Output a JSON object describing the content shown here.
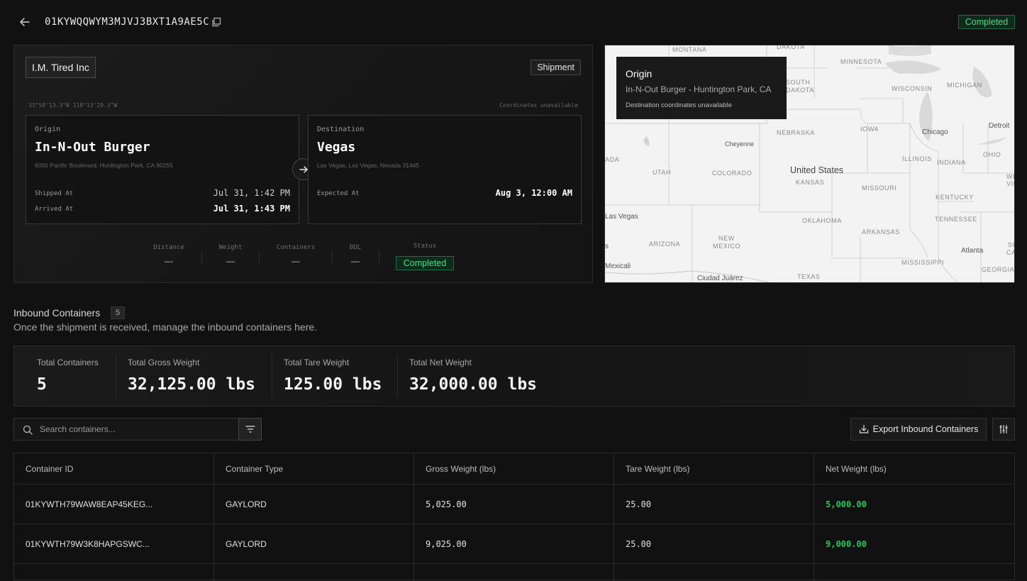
{
  "header": {
    "shipment_id": "01KYWQQWYM3MJVJ3BXT1A9AE5C",
    "status": "Completed"
  },
  "shipment": {
    "company": "I.M. Tired Inc",
    "type_badge": "Shipment",
    "origin_coords": "33°59'13.3\"N 118°13'29.3\"W",
    "dest_coords": "Coordinates unavailable",
    "origin": {
      "kind": "Origin",
      "name": "In-N-Out Burger",
      "address": "6000 Pacific Boulevard, Huntington Park, CA 90255",
      "shipped_label": "Shipped At",
      "shipped_value": "Jul 31, 1:42 PM",
      "arrived_label": "Arrived At",
      "arrived_value": "Jul 31, 1:43 PM"
    },
    "destination": {
      "kind": "Destination",
      "name": "Vegas",
      "address": "Las Vegas, Las Vegas, Nevada 31445",
      "expected_label": "Expected At",
      "expected_value": "Aug 3, 12:00 AM"
    },
    "stats": [
      {
        "label": "Distance",
        "value": "—"
      },
      {
        "label": "Weight",
        "value": "—"
      },
      {
        "label": "Containers",
        "value": "—"
      },
      {
        "label": "BOL",
        "value": "—"
      }
    ],
    "status_label": "Status",
    "status_value": "Completed"
  },
  "map": {
    "popup_title": "Origin",
    "popup_subtitle": "In-N-Out Burger - Huntington Park, CA",
    "popup_note": "Destination coordinates unavailable",
    "state_labels": [
      "MONTANA",
      "DAKOTA",
      "MINNESOTA",
      "SOUTH",
      "DAKOTA",
      "WISCONSIN",
      "MICHIGAN",
      "NEBRASKA",
      "IOWA",
      "UTAH",
      "COLORADO",
      "KANSAS",
      "ILLINOIS",
      "INDIANA",
      "OHIO",
      "MISSOURI",
      "KENTUCKY",
      "OKLAHOMA",
      "ARKANSAS",
      "TENNESSEE",
      "ARIZONA",
      "NEW",
      "MEXICO",
      "MISSISSIPPI",
      "GEORGIA",
      "TEXAS",
      "ADA",
      "WES",
      "VIRG",
      "SOUT",
      "CARO"
    ],
    "city_labels": [
      "Chicago",
      "Detroit",
      "Cheyenne",
      "United States",
      "Las Vegas",
      "Atlanta",
      "Mexicali",
      "Ciudad Juárez",
      "s"
    ]
  },
  "inbound": {
    "title": "Inbound Containers",
    "count": "5",
    "subtitle": "Once the shipment is received, manage the inbound containers here.",
    "totals": [
      {
        "label": "Total Containers",
        "value": "5"
      },
      {
        "label": "Total Gross Weight",
        "value": "32,125.00 lbs"
      },
      {
        "label": "Total Tare Weight",
        "value": "125.00 lbs"
      },
      {
        "label": "Total Net Weight",
        "value": "32,000.00 lbs"
      }
    ],
    "search_placeholder": "Search containers...",
    "export_label": "Export Inbound Containers",
    "columns": [
      "Container ID",
      "Container Type",
      "Gross Weight (lbs)",
      "Tare Weight (lbs)",
      "Net Weight (lbs)"
    ],
    "rows": [
      [
        "01KYWTH79WAW8EAP45KEG...",
        "GAYLORD",
        "5,025.00",
        "25.00",
        "5,000.00"
      ],
      [
        "01KYWTH79W3K8HAPGSWC...",
        "GAYLORD",
        "9,025.00",
        "25.00",
        "9,000.00"
      ]
    ]
  },
  "colors": {
    "status_green": "#4ade80",
    "net_weight_green": "#22c55e",
    "background": "#111111"
  }
}
